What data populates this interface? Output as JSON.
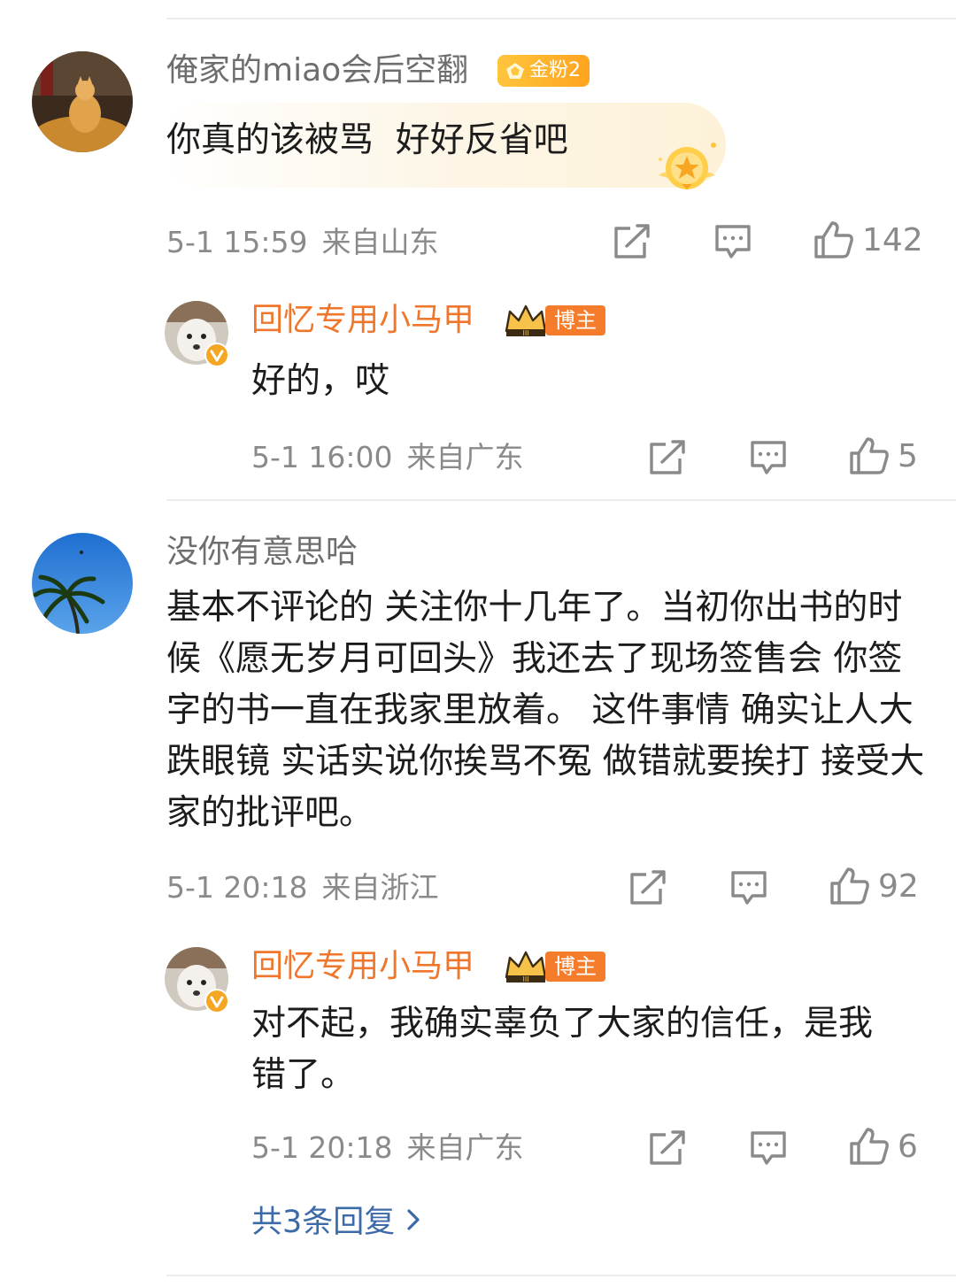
{
  "comments": [
    {
      "user": "俺家的miao会后空翻",
      "badge": "金粉2",
      "text": "你真的该被骂  好好反省吧",
      "time": "5-1 15:59",
      "location": "来自山东",
      "likes": "142",
      "reply": {
        "user": "回忆专用小马甲",
        "badge": "博主",
        "text": "好的，哎",
        "time": "5-1 16:00",
        "location": "来自广东",
        "likes": "5"
      }
    },
    {
      "user": "没你有意思哈",
      "text": "基本不评论的 关注你十几年了。当初你出书的时候《愿无岁月可回头》我还去了现场签售会 你签字的书一直在我家里放着。 这件事情 确实让人大跌眼镜 实话实说你挨骂不冤 做错就要挨打 接受大家的批评吧。",
      "time": "5-1 20:18",
      "location": "来自浙江",
      "likes": "92",
      "reply": {
        "user": "回忆专用小马甲",
        "badge": "博主",
        "text": "对不起，我确实辜负了大家的信任，是我错了。",
        "time": "5-1 20:18",
        "location": "来自广东",
        "likes": "6"
      },
      "more_replies": "共3条回复"
    }
  ],
  "icons": {
    "share": "share-icon",
    "comment": "comment-icon",
    "like": "thumbs-up-icon",
    "more": "chevron-right-icon",
    "verified": "verified-v-icon",
    "crown": "crown-icon"
  },
  "colors": {
    "username_grey": "#6e6e6e",
    "host_orange": "#f0762c",
    "meta_grey": "#8a8a8a",
    "link_blue": "#3d6aa8",
    "gold_badge": "#ffb02e"
  }
}
